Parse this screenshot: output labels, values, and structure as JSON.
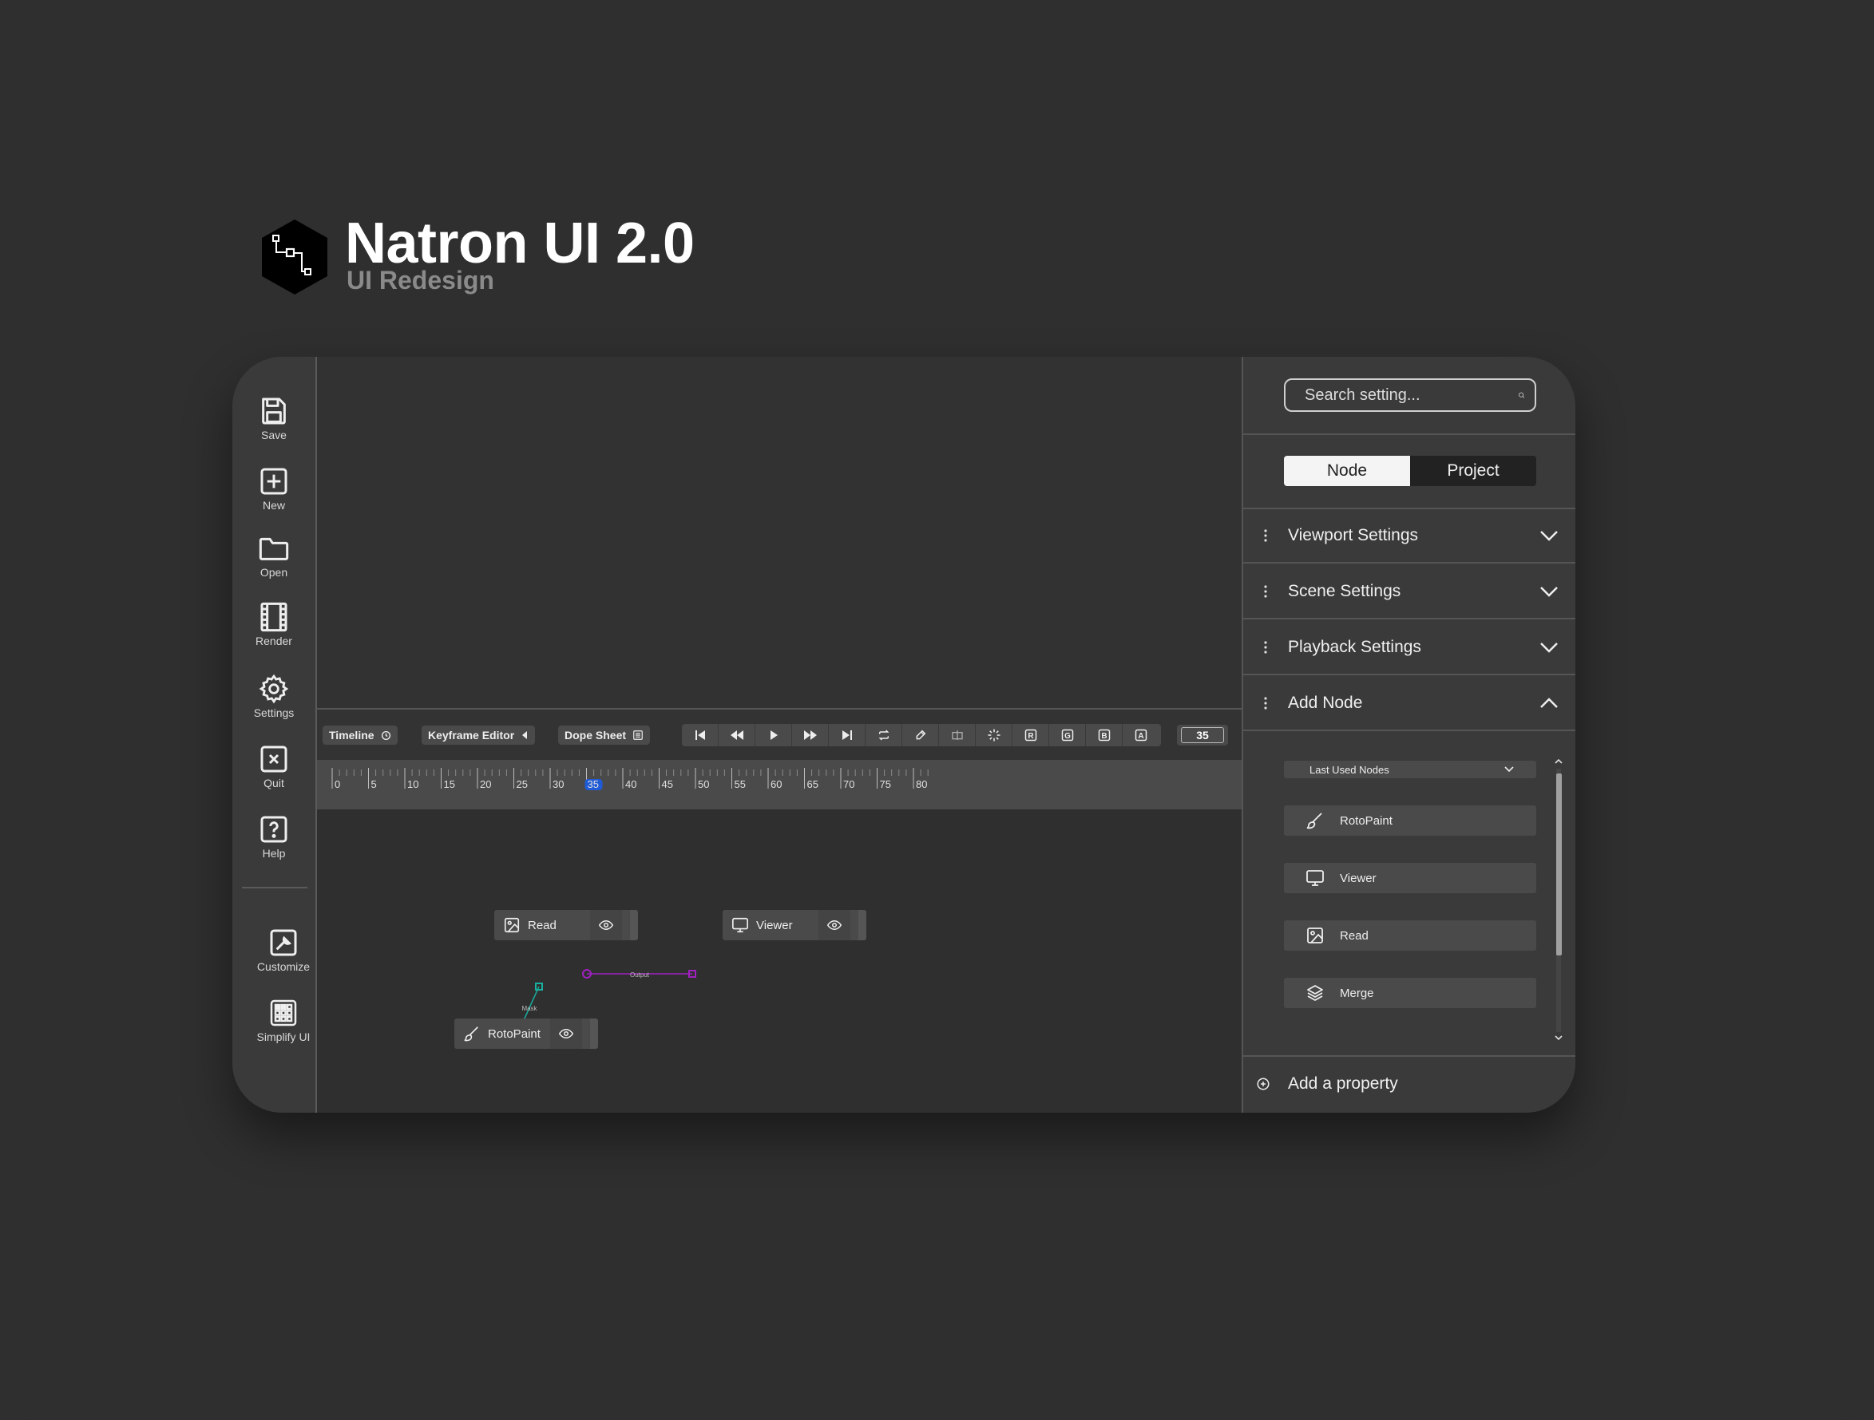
{
  "header": {
    "title": "Natron UI 2.0",
    "subtitle": "UI Redesign"
  },
  "sidebar": {
    "items": [
      {
        "label": "Save",
        "icon": "save-icon"
      },
      {
        "label": "New",
        "icon": "plus-square-icon"
      },
      {
        "label": "Open",
        "icon": "folder-icon"
      },
      {
        "label": "Render",
        "icon": "film-icon"
      },
      {
        "label": "Settings",
        "icon": "gear-icon"
      },
      {
        "label": "Quit",
        "icon": "close-square-icon"
      },
      {
        "label": "Help",
        "icon": "help-icon"
      },
      {
        "label": "Customize",
        "icon": "wrench-icon"
      },
      {
        "label": "Simplify UI",
        "icon": "grid-icon"
      }
    ]
  },
  "toolbar": {
    "timeline_label": "Timeline",
    "keyframe_label": "Keyframe Editor",
    "dopesheet_label": "Dope Sheet",
    "current_frame": "35",
    "channel_r": "R",
    "channel_g": "G",
    "channel_b": "B",
    "channel_a": "A"
  },
  "ruler": {
    "labels": [
      "0",
      "5",
      "10",
      "15",
      "20",
      "25",
      "30",
      "35",
      "40",
      "45",
      "50",
      "55",
      "60",
      "65",
      "70",
      "75",
      "80"
    ],
    "current": "35",
    "accent": "#1f5bd6"
  },
  "nodegraph": {
    "nodes": {
      "read": "Read",
      "viewer": "Viewer",
      "rotopaint": "RotoPaint"
    },
    "edges": {
      "output": "Output",
      "mask": "Mask"
    },
    "colors": {
      "output_edge": "#a020c0",
      "mask_edge": "#18b0a0"
    }
  },
  "panel": {
    "search_placeholder": "Search setting...",
    "tabs": {
      "node": "Node",
      "project": "Project",
      "active": "Node"
    },
    "sections": [
      {
        "label": "Viewport Settings",
        "expanded": false
      },
      {
        "label": "Scene Settings",
        "expanded": false
      },
      {
        "label": "Playback Settings",
        "expanded": false
      },
      {
        "label": "Add Node",
        "expanded": true
      }
    ],
    "node_dropdown": "Last Used Nodes",
    "node_list": [
      "RotoPaint",
      "Viewer",
      "Read",
      "Merge"
    ],
    "add_property": "Add a property"
  }
}
